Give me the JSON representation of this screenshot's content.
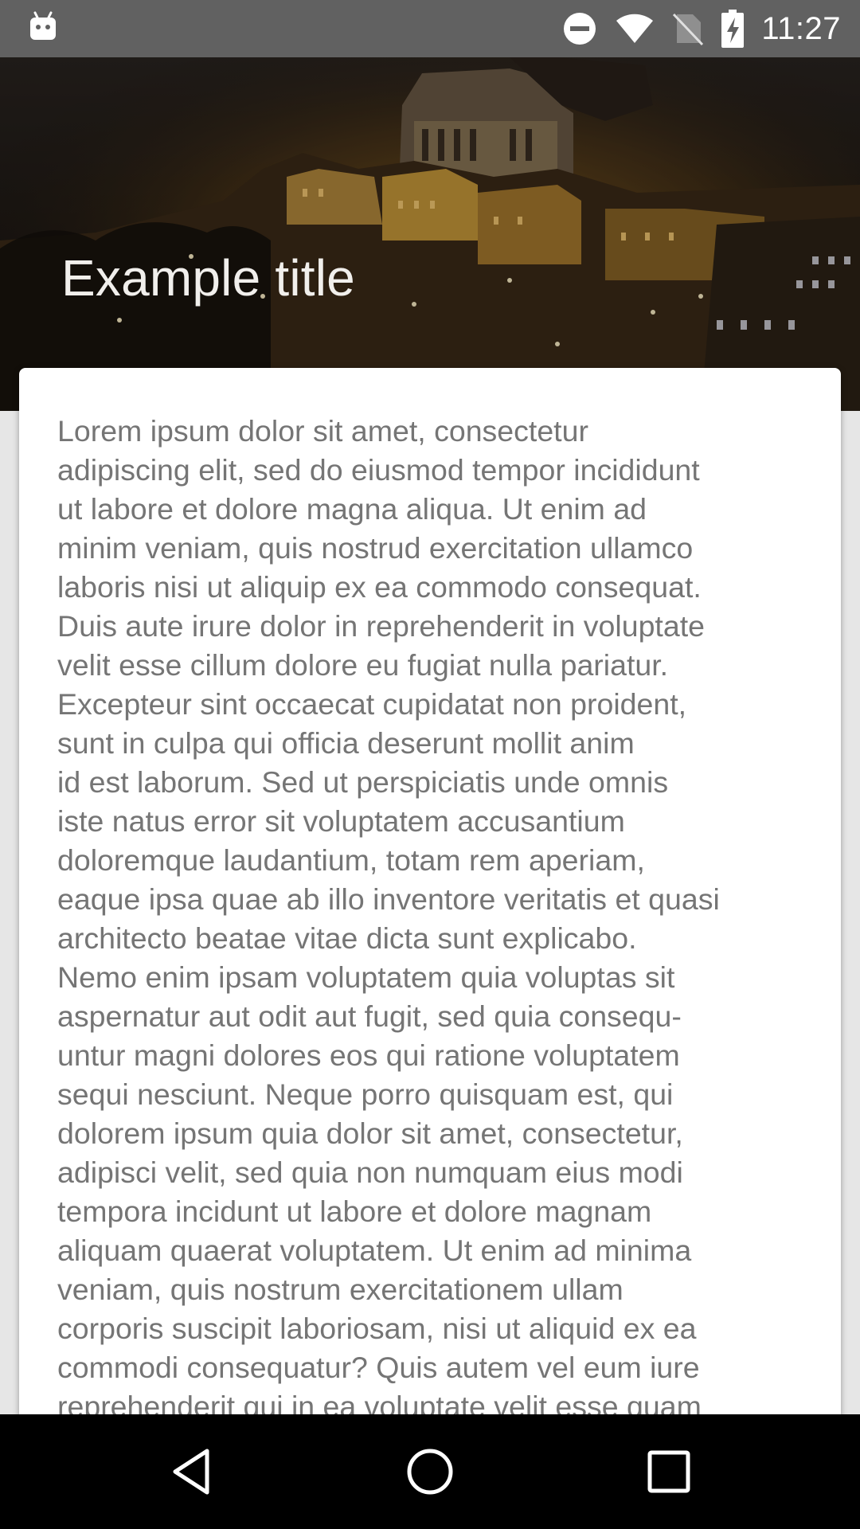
{
  "status_bar": {
    "time": "11:27",
    "icons": [
      "android-icon",
      "do-not-disturb-icon",
      "wifi-icon",
      "no-sim-icon",
      "battery-charging-icon"
    ]
  },
  "header": {
    "title": "Example title"
  },
  "card": {
    "body": "Lorem ipsum dolor sit amet, consectetur\nadipiscing elit, sed do eiusmod tempor incididunt\nut labore et dolore magna aliqua. Ut enim ad\nminim veniam, quis nostrud exercitation ullamco\nlaboris nisi ut aliquip ex ea commodo consequat.\nDuis aute irure dolor in reprehenderit in voluptate\nvelit esse cillum dolore eu fugiat nulla pariatur.\nExcepteur sint occaecat cupidatat non proident,\nsunt in culpa qui officia deserunt mollit anim\nid est laborum. Sed ut perspiciatis unde omnis\niste natus error sit voluptatem accusantium\ndoloremque laudantium, totam rem aperiam,\neaque ipsa quae ab illo inventore veritatis et quasi\narchitecto beatae vitae dicta sunt explicabo.\nNemo enim ipsam voluptatem quia voluptas sit\naspernatur aut odit aut fugit, sed quia consequ-\nuntur magni dolores eos qui ratione voluptatem\nsequi nesciunt. Neque porro quisquam est, qui\ndolorem ipsum quia dolor sit amet, consectetur,\nadipisci velit, sed quia non numquam eius modi\ntempora incidunt ut labore et dolore magnam\naliquam quaerat voluptatem. Ut enim ad minima\nveniam, quis nostrum exercitationem ullam\ncorporis suscipit laboriosam, nisi ut aliquid ex ea\ncommodi consequatur? Quis autem vel eum iure\nreprehenderit qui in ea voluptate velit esse quam"
  },
  "nav_bar": {
    "buttons": [
      "back-icon",
      "home-icon",
      "recents-icon"
    ]
  },
  "colors": {
    "status_bar": "#616161",
    "card_text": "#757575",
    "card_background": "#ffffff",
    "nav_bar": "#000000",
    "page_background": "#e6e6e6"
  }
}
